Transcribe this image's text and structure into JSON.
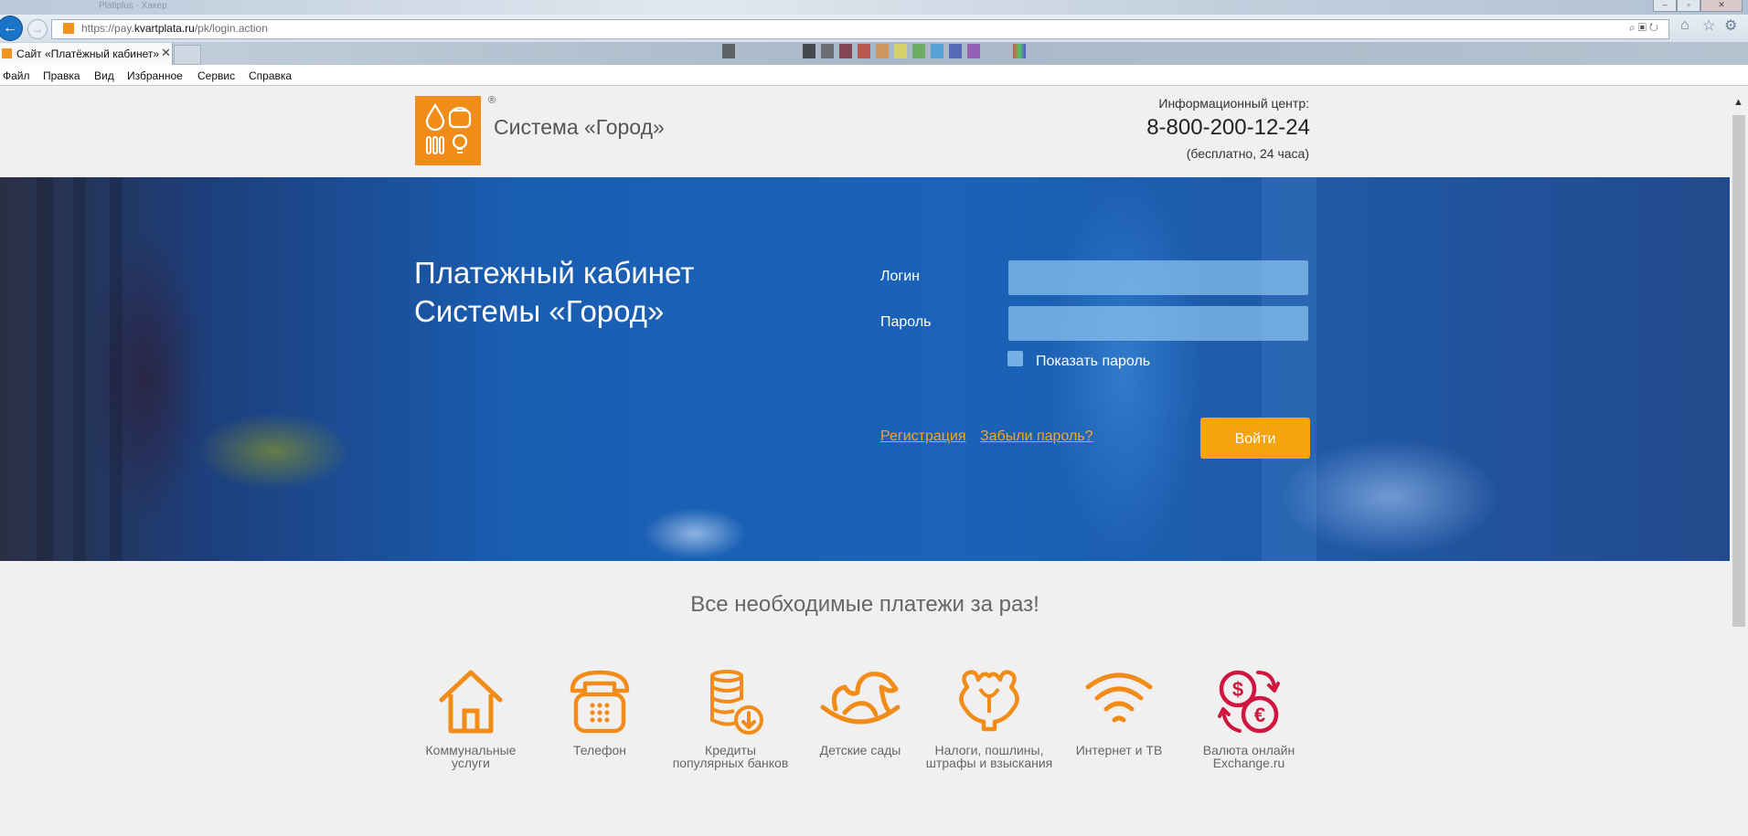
{
  "browser": {
    "title_text": "Platiplus - Хакер",
    "url_prefix": "https://pay.",
    "url_domain": "kvartplata.ru",
    "url_path": "/pk/login.action",
    "tab_title": "Сайт «Платёжный кабинет»",
    "tab_close": "✕",
    "window_buttons": [
      "–",
      "▫",
      "✕"
    ],
    "menu": [
      "Файл",
      "Правка",
      "Вид",
      "Избранное",
      "Сервис",
      "Справка"
    ]
  },
  "header": {
    "brand": "Система «Город»",
    "registered_mark": "®",
    "info_label": "Информационный центр:",
    "phone": "8-800-200-12-24",
    "phone_note": "(бесплатно, 24 часа)"
  },
  "hero": {
    "title": "Платежный кабинет\nСистемы «Город»",
    "login_label": "Логин",
    "login_value": "",
    "password_label": "Пароль",
    "password_value": "",
    "show_password_label": "Показать пароль",
    "show_password_checked": false,
    "register_link": "Регистрация",
    "forgot_link": "Забыли пароль?",
    "login_button": "Войти"
  },
  "services": {
    "tagline": "Все необходимые платежи за раз!",
    "items": [
      {
        "label": "Коммунальные\nуслуги",
        "icon": "house-icon"
      },
      {
        "label": "Телефон",
        "icon": "telephone-icon"
      },
      {
        "label": "Кредиты\nпопулярных банков",
        "icon": "coins-icon"
      },
      {
        "label": "Детские сады",
        "icon": "rocking-horse-icon"
      },
      {
        "label": "Налоги, пошлины,\nштрафы и взыскания",
        "icon": "emblem-icon"
      },
      {
        "label": "Интернет и ТВ",
        "icon": "wifi-icon"
      },
      {
        "label": "Валюта онлайн\nExchange.ru",
        "icon": "currency-exchange-icon"
      }
    ]
  },
  "colors": {
    "brand_orange": "#f28c18",
    "button_orange": "#f5a30f",
    "link_orange": "#f5a623",
    "exchange_red": "#d0163f"
  }
}
